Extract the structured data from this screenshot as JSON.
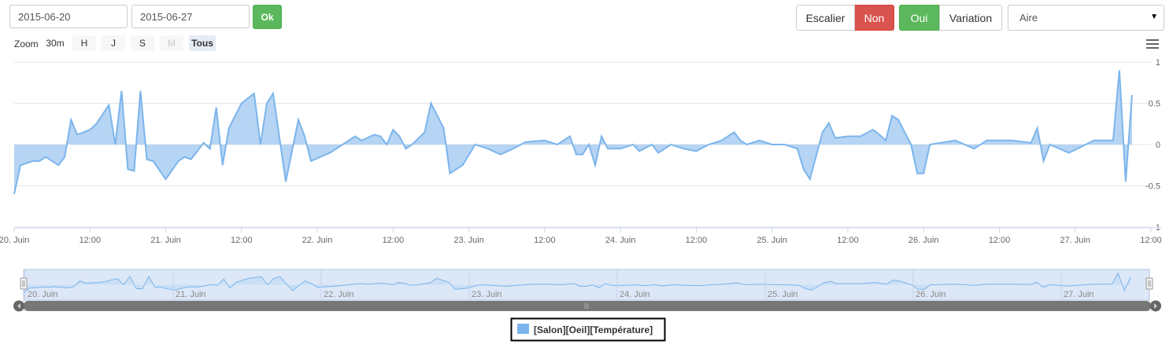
{
  "controls": {
    "date_start": "2015-06-20",
    "date_end": "2015-06-27",
    "ok_label": "Ok",
    "escalier_label": "Escalier",
    "non_label": "Non",
    "oui_label": "Oui",
    "variation_label": "Variation",
    "select_value": "Aire"
  },
  "colors": {
    "series_fill": "#a9cdf1",
    "series_line": "#7cb5ec",
    "ok_green": "#5cb85c",
    "non_red": "#d9534f",
    "navigator_mask": "#dce8f7"
  },
  "range_selector": {
    "zoom_label": "Zoom",
    "buttons": [
      "30m",
      "H",
      "J",
      "S",
      "M",
      "Tous"
    ],
    "active": "Tous",
    "disabled": [
      "M"
    ]
  },
  "icons": {
    "menu": "hamburger-menu-icon",
    "select": "chevron-down-icon"
  },
  "chart_data": {
    "type": "area",
    "title": "",
    "xlabel": "",
    "ylabel": "",
    "x_start": "2015-06-20 00:00",
    "x_end": "2015-06-27 12:00",
    "ylim": [
      -1,
      1
    ],
    "yticks": [
      "1",
      "0.5",
      "0",
      "-0.5",
      "-1"
    ],
    "xticks": [
      "20. Juin",
      "12:00",
      "21. Juin",
      "12:00",
      "22. Juin",
      "12:00",
      "23. Juin",
      "12:00",
      "24. Juin",
      "12:00",
      "25. Juin",
      "12:00",
      "26. Juin",
      "12:00",
      "27. Juin",
      "12:00"
    ],
    "navigator_ticks": [
      "20. Juin",
      "21. Juin",
      "22. Juin",
      "23. Juin",
      "24. Juin",
      "25. Juin",
      "26. Juin",
      "27. Juin"
    ],
    "grid": true,
    "legend": "bottom-center",
    "series": [
      {
        "name": "[Salon][Oeil][Température]",
        "points": [
          [
            "2015-06-20 00:00",
            -0.6
          ],
          [
            "2015-06-20 01:00",
            -0.25
          ],
          [
            "2015-06-20 03:00",
            -0.2
          ],
          [
            "2015-06-20 04:00",
            -0.2
          ],
          [
            "2015-06-20 05:00",
            -0.15
          ],
          [
            "2015-06-20 07:00",
            -0.25
          ],
          [
            "2015-06-20 08:00",
            -0.15
          ],
          [
            "2015-06-20 09:00",
            0.3
          ],
          [
            "2015-06-20 10:00",
            0.12
          ],
          [
            "2015-06-20 12:00",
            0.18
          ],
          [
            "2015-06-20 13:00",
            0.25
          ],
          [
            "2015-06-20 15:00",
            0.48
          ],
          [
            "2015-06-20 16:00",
            0.0
          ],
          [
            "2015-06-20 17:00",
            0.65
          ],
          [
            "2015-06-20 18:00",
            -0.3
          ],
          [
            "2015-06-20 19:00",
            -0.32
          ],
          [
            "2015-06-20 20:00",
            0.65
          ],
          [
            "2015-06-20 21:00",
            -0.18
          ],
          [
            "2015-06-20 22:00",
            -0.2
          ],
          [
            "2015-06-21 00:00",
            -0.42
          ],
          [
            "2015-06-21 02:00",
            -0.2
          ],
          [
            "2015-06-21 03:00",
            -0.15
          ],
          [
            "2015-06-21 04:00",
            -0.18
          ],
          [
            "2015-06-21 06:00",
            0.02
          ],
          [
            "2015-06-21 07:00",
            -0.05
          ],
          [
            "2015-06-21 08:00",
            0.45
          ],
          [
            "2015-06-21 09:00",
            -0.25
          ],
          [
            "2015-06-21 10:00",
            0.2
          ],
          [
            "2015-06-21 12:00",
            0.5
          ],
          [
            "2015-06-21 14:00",
            0.62
          ],
          [
            "2015-06-21 15:00",
            0.0
          ],
          [
            "2015-06-21 16:00",
            0.5
          ],
          [
            "2015-06-21 17:00",
            0.62
          ],
          [
            "2015-06-21 19:00",
            -0.45
          ],
          [
            "2015-06-21 21:00",
            0.3
          ],
          [
            "2015-06-21 22:00",
            0.1
          ],
          [
            "2015-06-21 23:00",
            -0.2
          ],
          [
            "2015-06-22 02:00",
            -0.1
          ],
          [
            "2015-06-22 04:00",
            0.0
          ],
          [
            "2015-06-22 06:00",
            0.1
          ],
          [
            "2015-06-22 07:00",
            0.05
          ],
          [
            "2015-06-22 09:00",
            0.12
          ],
          [
            "2015-06-22 10:00",
            0.1
          ],
          [
            "2015-06-22 11:00",
            0.0
          ],
          [
            "2015-06-22 12:00",
            0.18
          ],
          [
            "2015-06-22 13:00",
            0.1
          ],
          [
            "2015-06-22 14:00",
            -0.05
          ],
          [
            "2015-06-22 15:00",
            0.0
          ],
          [
            "2015-06-22 17:00",
            0.15
          ],
          [
            "2015-06-22 18:00",
            0.5
          ],
          [
            "2015-06-22 20:00",
            0.2
          ],
          [
            "2015-06-22 21:00",
            -0.35
          ],
          [
            "2015-06-22 23:00",
            -0.25
          ],
          [
            "2015-06-23 01:00",
            0.0
          ],
          [
            "2015-06-23 03:00",
            -0.05
          ],
          [
            "2015-06-23 05:00",
            -0.12
          ],
          [
            "2015-06-23 07:00",
            -0.05
          ],
          [
            "2015-06-23 09:00",
            0.03
          ],
          [
            "2015-06-23 12:00",
            0.05
          ],
          [
            "2015-06-23 14:00",
            0.0
          ],
          [
            "2015-06-23 16:00",
            0.1
          ],
          [
            "2015-06-23 17:00",
            -0.12
          ],
          [
            "2015-06-23 18:00",
            -0.12
          ],
          [
            "2015-06-23 19:00",
            0.0
          ],
          [
            "2015-06-23 20:00",
            -0.25
          ],
          [
            "2015-06-23 21:00",
            0.1
          ],
          [
            "2015-06-23 22:00",
            -0.05
          ],
          [
            "2015-06-24 00:00",
            -0.05
          ],
          [
            "2015-06-24 02:00",
            0.0
          ],
          [
            "2015-06-24 03:00",
            -0.08
          ],
          [
            "2015-06-24 05:00",
            0.0
          ],
          [
            "2015-06-24 06:00",
            -0.1
          ],
          [
            "2015-06-24 07:00",
            -0.05
          ],
          [
            "2015-06-24 08:00",
            0.0
          ],
          [
            "2015-06-24 10:00",
            -0.05
          ],
          [
            "2015-06-24 12:00",
            -0.08
          ],
          [
            "2015-06-24 14:00",
            0.0
          ],
          [
            "2015-06-24 16:00",
            0.05
          ],
          [
            "2015-06-24 18:00",
            0.15
          ],
          [
            "2015-06-24 19:00",
            0.05
          ],
          [
            "2015-06-24 20:00",
            0.0
          ],
          [
            "2015-06-24 22:00",
            0.05
          ],
          [
            "2015-06-25 00:00",
            0.0
          ],
          [
            "2015-06-25 02:00",
            0.0
          ],
          [
            "2015-06-25 04:00",
            -0.05
          ],
          [
            "2015-06-25 05:00",
            -0.3
          ],
          [
            "2015-06-25 06:00",
            -0.42
          ],
          [
            "2015-06-25 08:00",
            0.15
          ],
          [
            "2015-06-25 09:00",
            0.26
          ],
          [
            "2015-06-25 10:00",
            0.08
          ],
          [
            "2015-06-25 12:00",
            0.1
          ],
          [
            "2015-06-25 14:00",
            0.1
          ],
          [
            "2015-06-25 16:00",
            0.18
          ],
          [
            "2015-06-25 17:00",
            0.12
          ],
          [
            "2015-06-25 18:00",
            0.05
          ],
          [
            "2015-06-25 19:00",
            0.35
          ],
          [
            "2015-06-25 20:00",
            0.3
          ],
          [
            "2015-06-25 22:00",
            0.0
          ],
          [
            "2015-06-25 23:00",
            -0.35
          ],
          [
            "2015-06-26 00:00",
            -0.35
          ],
          [
            "2015-06-26 01:00",
            0.0
          ],
          [
            "2015-06-26 05:00",
            0.05
          ],
          [
            "2015-06-26 08:00",
            -0.05
          ],
          [
            "2015-06-26 10:00",
            0.05
          ],
          [
            "2015-06-26 14:00",
            0.05
          ],
          [
            "2015-06-26 17:00",
            0.02
          ],
          [
            "2015-06-26 18:00",
            0.2
          ],
          [
            "2015-06-26 19:00",
            -0.2
          ],
          [
            "2015-06-26 20:00",
            0.0
          ],
          [
            "2015-06-26 23:00",
            -0.1
          ],
          [
            "2015-06-27 03:00",
            0.05
          ],
          [
            "2015-06-27 06:00",
            0.05
          ],
          [
            "2015-06-27 07:00",
            0.9
          ],
          [
            "2015-06-27 08:00",
            -0.45
          ],
          [
            "2015-06-27 09:00",
            0.6
          ]
        ]
      }
    ]
  }
}
